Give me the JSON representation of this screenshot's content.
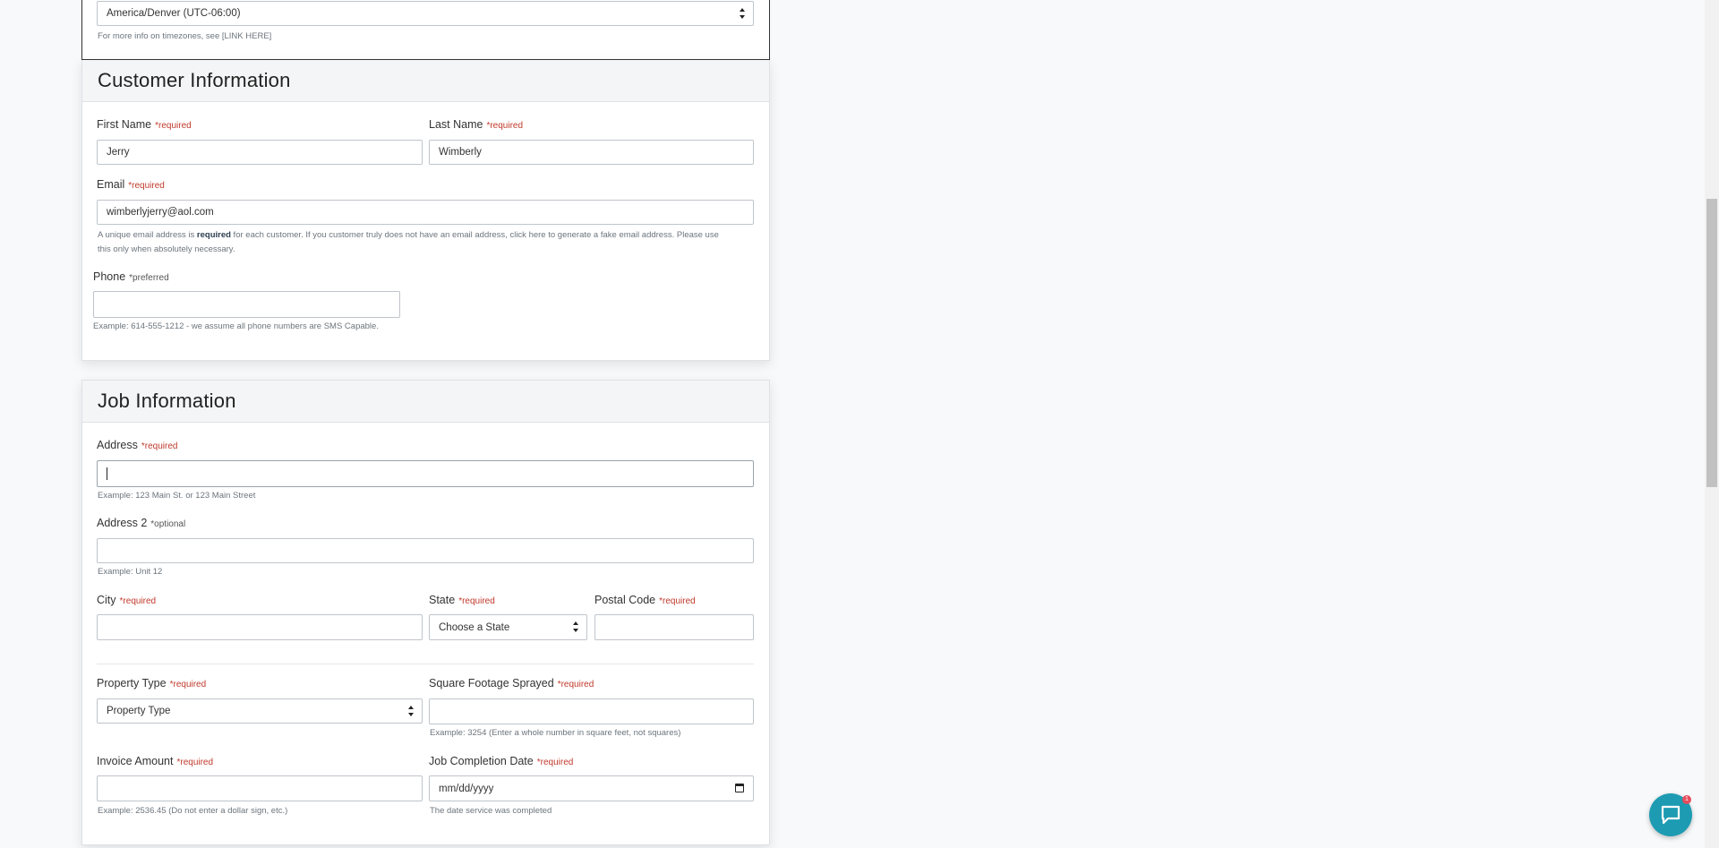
{
  "timezone": {
    "selected": "America/Denver (UTC-06:00)",
    "help": "For more info on timezones, see [LINK HERE]"
  },
  "customer": {
    "title": "Customer Information",
    "first_name": {
      "label": "First Name",
      "req": "*required",
      "value": "Jerry"
    },
    "last_name": {
      "label": "Last Name",
      "req": "*required",
      "value": "Wimberly"
    },
    "email": {
      "label": "Email",
      "req": "*required",
      "value": "wimberlyjerry@aol.com",
      "help_pre": "A unique email address is ",
      "help_bold": "required",
      "help_post": " for each customer. If you customer truly does not have an email address, click here to generate a fake email address. Please use",
      "help_line2": "this only when absolutely necessary."
    },
    "phone": {
      "label": "Phone",
      "pref": "*preferred",
      "value": "",
      "help": "Example: 614-555-1212 - we assume all phone numbers are SMS Capable."
    }
  },
  "job": {
    "title": "Job Information",
    "address": {
      "label": "Address",
      "req": "*required",
      "value": "",
      "help": "Example: 123 Main St. or 123 Main Street"
    },
    "address2": {
      "label": "Address 2",
      "opt": "*optional",
      "value": "",
      "help": "Example: Unit 12"
    },
    "city": {
      "label": "City",
      "req": "*required",
      "value": ""
    },
    "state": {
      "label": "State",
      "req": "*required",
      "selected": "Choose a State"
    },
    "postal": {
      "label": "Postal Code",
      "req": "*required",
      "value": ""
    },
    "property_type": {
      "label": "Property Type",
      "req": "*required",
      "selected": "Property Type"
    },
    "sqft": {
      "label": "Square Footage Sprayed",
      "req": "*required",
      "value": "",
      "help": "Example: 3254 (Enter a whole number in square feet, not squares)"
    },
    "invoice": {
      "label": "Invoice Amount",
      "req": "*required",
      "value": "",
      "help": "Example: 2536.45 (Do not enter a dollar sign, etc.)"
    },
    "completion": {
      "label": "Job Completion Date",
      "req": "*required",
      "placeholder": "mm/dd/yyyy",
      "help": "The date service was completed"
    }
  },
  "chat": {
    "badge": "1",
    "icon": "chat-bubble-icon"
  },
  "colors": {
    "required": "#c0392b",
    "chat": "#1d9bb3",
    "badge": "#e74c5b"
  }
}
